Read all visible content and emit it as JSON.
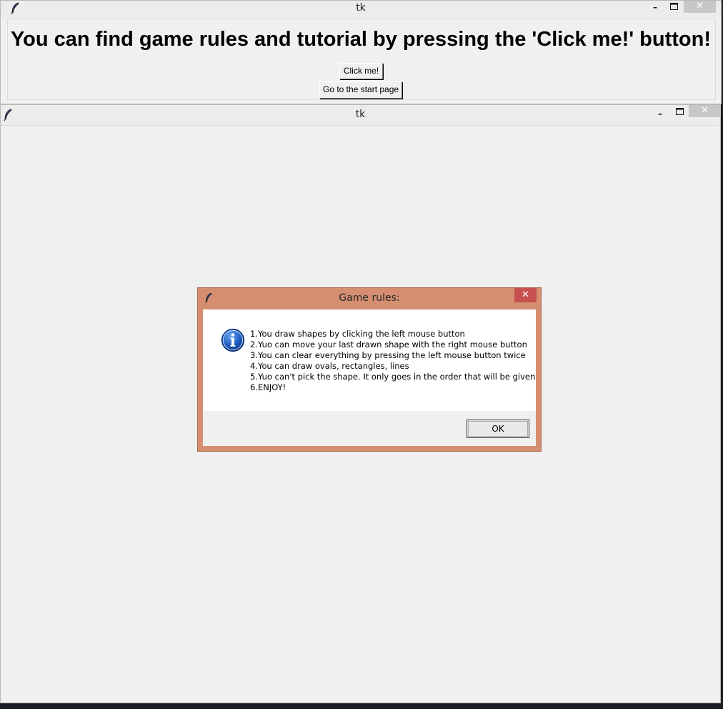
{
  "window1": {
    "title": "tk",
    "minimize_label": "–",
    "maximize_label": "🗖",
    "close_label": "✕",
    "heading": "You can find game rules and tutorial by pressing the 'Click me!' button!",
    "click_button": "Click me!",
    "start_button": "Go to the start page"
  },
  "window2": {
    "title": "tk",
    "minimize_label": "–",
    "maximize_label": "🗖",
    "close_label": "✕"
  },
  "dialog": {
    "title": "Game rules:",
    "close_label": "✕",
    "icon": "info-icon",
    "lines": [
      "1.You draw shapes by clicking the left mouse button",
      "2.Yuo can move your last drawn shape with the right mouse button",
      "3.You can clear everything by pressing the left mouse button twice",
      "4.You can draw ovals, rectangles, lines",
      "5.Yuo can't pick the shape. It only goes in the order that will be given",
      "6.ENJOY!"
    ],
    "ok_label": "OK"
  },
  "colors": {
    "dialog_frame": "#d58f70",
    "close_red": "#c75050",
    "window_bg": "#f0f0f0"
  }
}
